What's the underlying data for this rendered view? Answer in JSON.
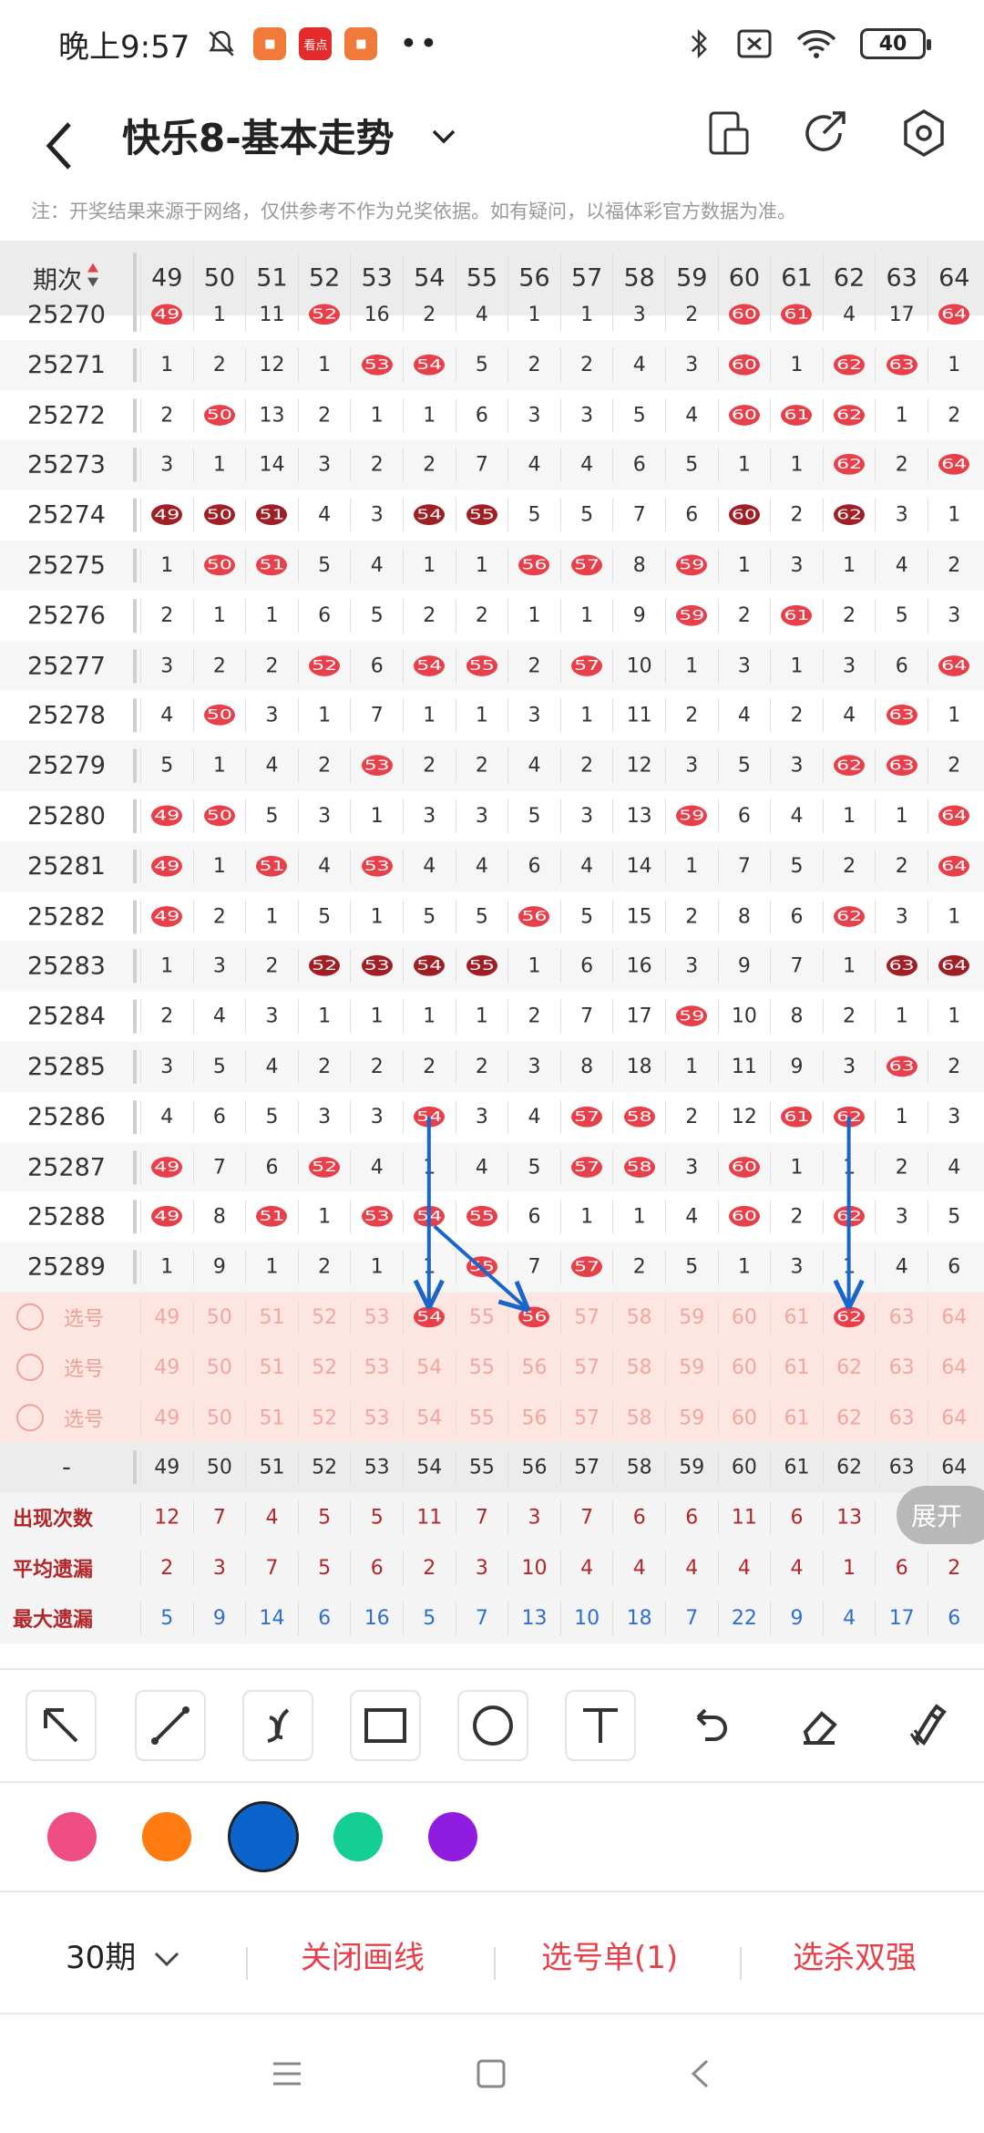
{
  "status": {
    "time": "晚上9:57",
    "battery": "40",
    "app_badge": "看点"
  },
  "header": {
    "title": "快乐8-基本走势"
  },
  "notice": "注：开奖结果来源于网络，仅供参考不作为兑奖依据。如有疑问，以福体彩官方数据为准。",
  "table": {
    "issue_header": "期次",
    "columns": [
      "49",
      "50",
      "51",
      "52",
      "53",
      "54",
      "55",
      "56",
      "57",
      "58",
      "59",
      "60",
      "61",
      "62",
      "63",
      "64"
    ],
    "rows": [
      {
        "issue": "25270",
        "cells": [
          "49",
          "1",
          "11",
          "52",
          "16",
          "2",
          "4",
          "1",
          "1",
          "3",
          "2",
          "60",
          "61",
          "4",
          "17",
          "64"
        ]
      },
      {
        "issue": "25271",
        "cells": [
          "1",
          "2",
          "12",
          "1",
          "53",
          "54",
          "5",
          "2",
          "2",
          "4",
          "3",
          "60",
          "1",
          "62",
          "63",
          "1"
        ]
      },
      {
        "issue": "25272",
        "cells": [
          "2",
          "50",
          "13",
          "2",
          "1",
          "1",
          "6",
          "3",
          "3",
          "5",
          "4",
          "60",
          "61",
          "62",
          "1",
          "2"
        ]
      },
      {
        "issue": "25273",
        "cells": [
          "3",
          "1",
          "14",
          "3",
          "2",
          "2",
          "7",
          "4",
          "4",
          "6",
          "5",
          "1",
          "1",
          "62",
          "2",
          "64"
        ]
      },
      {
        "issue": "25274",
        "cells": [
          "49",
          "50",
          "51",
          "4",
          "3",
          "54",
          "55",
          "5",
          "5",
          "7",
          "6",
          "60",
          "2",
          "62",
          "3",
          "1"
        ]
      },
      {
        "issue": "25275",
        "cells": [
          "1",
          "50",
          "51",
          "5",
          "4",
          "1",
          "1",
          "56",
          "57",
          "8",
          "59",
          "1",
          "3",
          "1",
          "4",
          "2"
        ]
      },
      {
        "issue": "25276",
        "cells": [
          "2",
          "1",
          "1",
          "6",
          "5",
          "2",
          "2",
          "1",
          "1",
          "9",
          "59",
          "2",
          "61",
          "2",
          "5",
          "3"
        ]
      },
      {
        "issue": "25277",
        "cells": [
          "3",
          "2",
          "2",
          "52",
          "6",
          "54",
          "55",
          "2",
          "57",
          "10",
          "1",
          "3",
          "1",
          "3",
          "6",
          "64"
        ]
      },
      {
        "issue": "25278",
        "cells": [
          "4",
          "50",
          "3",
          "1",
          "7",
          "1",
          "1",
          "3",
          "1",
          "11",
          "2",
          "4",
          "2",
          "4",
          "63",
          "1"
        ]
      },
      {
        "issue": "25279",
        "cells": [
          "5",
          "1",
          "4",
          "2",
          "53",
          "2",
          "2",
          "4",
          "2",
          "12",
          "3",
          "5",
          "3",
          "62",
          "63",
          "2"
        ]
      },
      {
        "issue": "25280",
        "cells": [
          "49",
          "50",
          "5",
          "3",
          "1",
          "3",
          "3",
          "5",
          "3",
          "13",
          "59",
          "6",
          "4",
          "1",
          "1",
          "64"
        ]
      },
      {
        "issue": "25281",
        "cells": [
          "49",
          "1",
          "51",
          "4",
          "53",
          "4",
          "4",
          "6",
          "4",
          "14",
          "1",
          "7",
          "5",
          "2",
          "2",
          "64"
        ]
      },
      {
        "issue": "25282",
        "cells": [
          "49",
          "2",
          "1",
          "5",
          "1",
          "5",
          "5",
          "56",
          "5",
          "15",
          "2",
          "8",
          "6",
          "62",
          "3",
          "1"
        ]
      },
      {
        "issue": "25283",
        "cells": [
          "1",
          "3",
          "2",
          "52",
          "53",
          "54",
          "55",
          "1",
          "6",
          "16",
          "3",
          "9",
          "7",
          "1",
          "63",
          "64"
        ]
      },
      {
        "issue": "25284",
        "cells": [
          "2",
          "4",
          "3",
          "1",
          "1",
          "1",
          "1",
          "2",
          "7",
          "17",
          "59",
          "10",
          "8",
          "2",
          "1",
          "1"
        ]
      },
      {
        "issue": "25285",
        "cells": [
          "3",
          "5",
          "4",
          "2",
          "2",
          "2",
          "2",
          "3",
          "8",
          "18",
          "1",
          "11",
          "9",
          "3",
          "63",
          "2"
        ]
      },
      {
        "issue": "25286",
        "cells": [
          "4",
          "6",
          "5",
          "3",
          "3",
          "54",
          "3",
          "4",
          "57",
          "58",
          "2",
          "12",
          "61",
          "62",
          "1",
          "3"
        ]
      },
      {
        "issue": "25287",
        "cells": [
          "49",
          "7",
          "6",
          "52",
          "4",
          "1",
          "4",
          "5",
          "57",
          "58",
          "3",
          "60",
          "1",
          "1",
          "2",
          "4"
        ]
      },
      {
        "issue": "25288",
        "cells": [
          "49",
          "8",
          "51",
          "1",
          "53",
          "54",
          "55",
          "6",
          "1",
          "1",
          "4",
          "60",
          "2",
          "62",
          "3",
          "5"
        ]
      },
      {
        "issue": "25289",
        "cells": [
          "1",
          "9",
          "1",
          "2",
          "1",
          "1",
          "55",
          "7",
          "57",
          "2",
          "5",
          "1",
          "3",
          "1",
          "4",
          "6"
        ]
      }
    ],
    "pick_label": "选号",
    "stat_header_first": "-",
    "stats": [
      {
        "label": "出现次数",
        "values": [
          "12",
          "7",
          "4",
          "5",
          "5",
          "11",
          "7",
          "3",
          "7",
          "6",
          "6",
          "11",
          "6",
          "13",
          "",
          "2"
        ]
      },
      {
        "label": "平均遗漏",
        "values": [
          "2",
          "3",
          "7",
          "5",
          "6",
          "2",
          "3",
          "10",
          "4",
          "4",
          "4",
          "4",
          "4",
          "1",
          "6",
          "2"
        ]
      },
      {
        "label": "最大遗漏",
        "values": [
          "5",
          "9",
          "14",
          "6",
          "16",
          "5",
          "7",
          "13",
          "10",
          "18",
          "7",
          "22",
          "9",
          "4",
          "17",
          "6"
        ]
      }
    ],
    "colors": {
      "ball": "#e8404a",
      "ball_dark": "#a01f25",
      "stat_blue": "#2f6fd1",
      "stat_red": "#b2262a"
    }
  },
  "expand_label": "展开",
  "tools": [
    "select-arrow-icon",
    "line-icon",
    "curve-icon",
    "rectangle-icon",
    "circle-icon",
    "text-icon",
    "undo-icon",
    "eraser-icon",
    "clear-brush-icon"
  ],
  "palette": [
    "#ee4e84",
    "#ff7a10",
    "#0b63cc",
    "#13cf94",
    "#8f1de0"
  ],
  "bottom": {
    "period": "30期",
    "close_draw": "关闭画线",
    "pick_list": "选号单(1)",
    "kill": "选杀双强"
  }
}
